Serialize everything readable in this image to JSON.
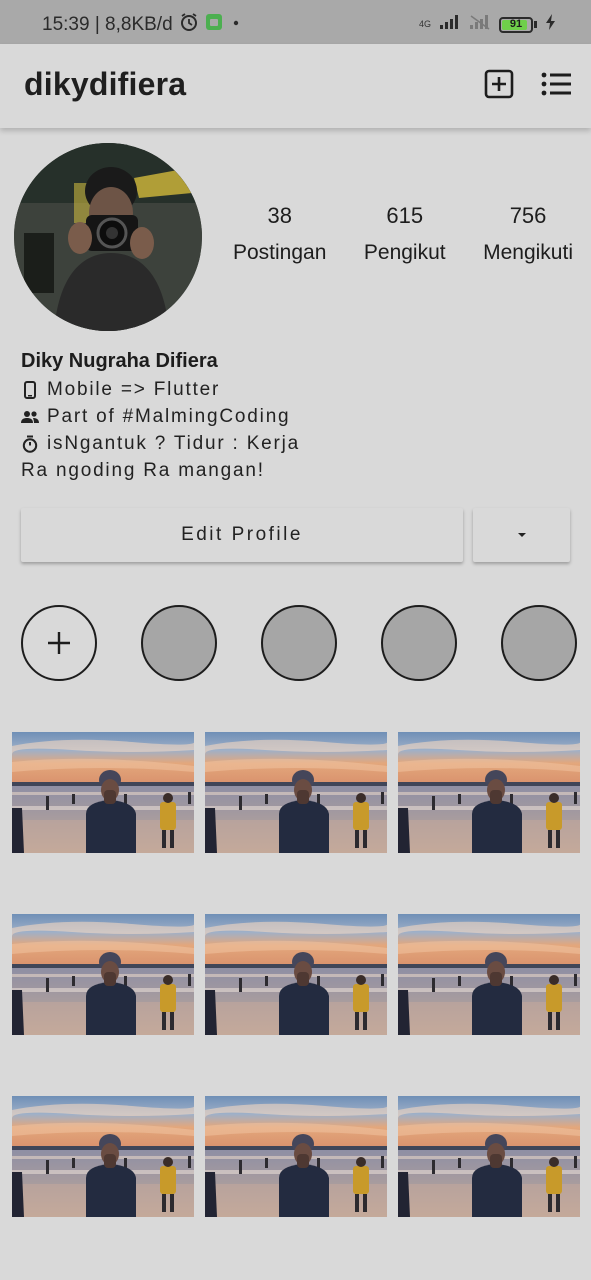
{
  "status_bar": {
    "time_speed": "15:39 | 8,8KB/d",
    "network_label": "4G",
    "battery_level": "91",
    "battery_percent": 91
  },
  "app_bar": {
    "username": "dikydifiera",
    "icons": [
      "add-post-icon",
      "menu-icon"
    ]
  },
  "profile": {
    "stats": [
      {
        "value": "38",
        "label": "Postingan"
      },
      {
        "value": "615",
        "label": "Pengikut"
      },
      {
        "value": "756",
        "label": "Mengikuti"
      }
    ],
    "name": "Diky Nugraha Difiera",
    "bio": [
      {
        "icon": "phone-icon",
        "text": "Mobile => Flutter"
      },
      {
        "icon": "people-icon",
        "text": "Part of #MalmingCoding"
      },
      {
        "icon": "timer-icon",
        "text": "isNgantuk ? Tidur : Kerja"
      },
      {
        "icon": "",
        "text": "Ra ngoding Ra mangan!"
      }
    ],
    "edit_label": "Edit Profile"
  },
  "highlights": {
    "count": 5,
    "add_icon": "plus-icon"
  },
  "posts": {
    "rows": 3,
    "columns": 3
  },
  "colors": {
    "background": "#d9d9d9",
    "status_bar": "#a9a9a9",
    "highlight_fill": "#a6a6a6",
    "battery": "#6fcf4a"
  }
}
